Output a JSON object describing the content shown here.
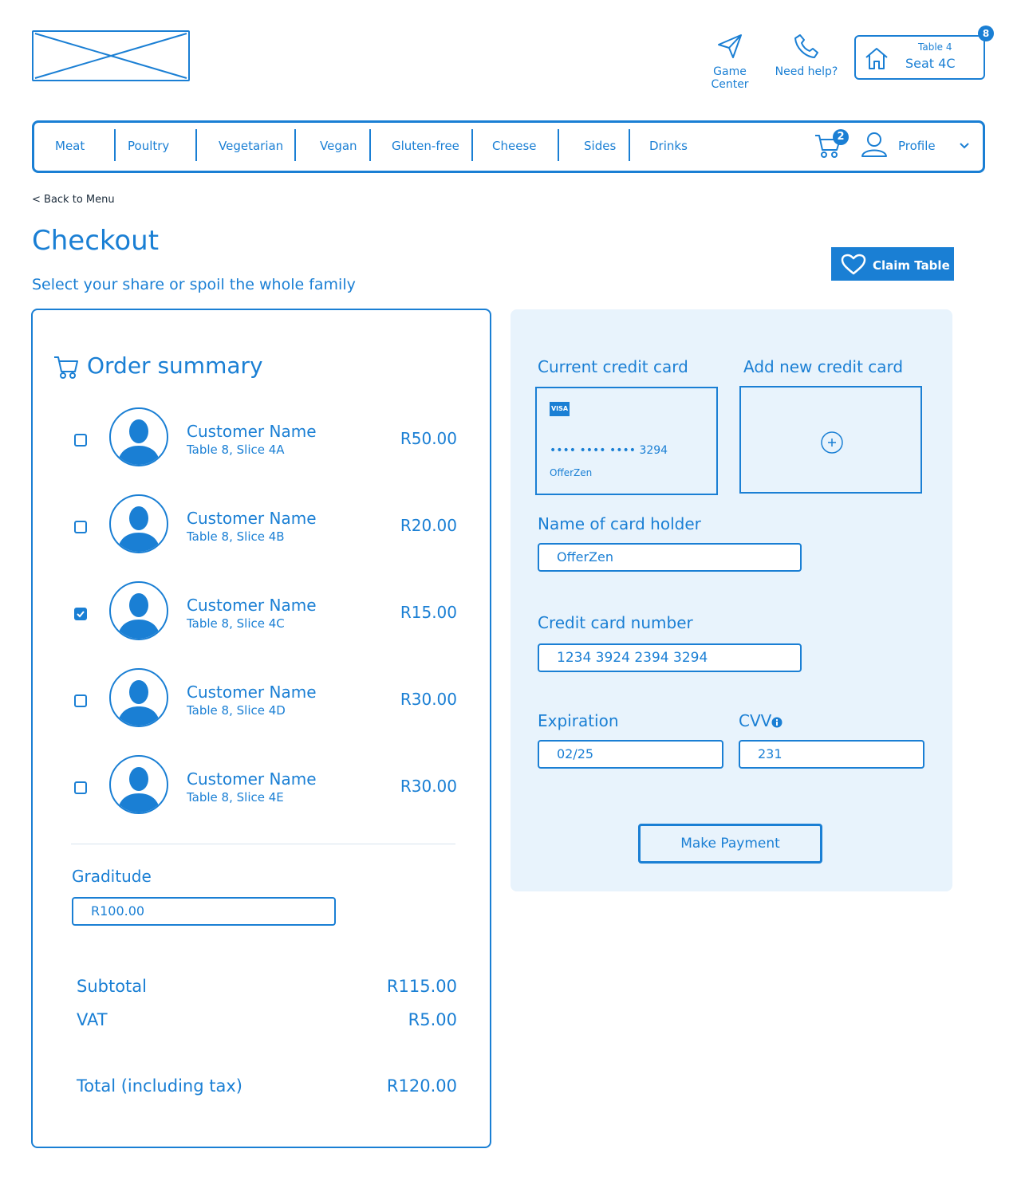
{
  "header": {
    "game_center": "Game Center",
    "need_help": "Need help?",
    "table_label": "Table 4",
    "seat_label": "Seat 4C",
    "notification_count": "8"
  },
  "nav": {
    "items": [
      "Meat",
      "Poultry",
      "Vegetarian",
      "Vegan",
      "Gluten-free",
      "Cheese",
      "Sides",
      "Drinks"
    ],
    "cart_count": "2",
    "profile": "Profile"
  },
  "page": {
    "back_link": "< Back to Menu",
    "title": "Checkout",
    "subtitle": "Select your share or spoil the whole family",
    "claim_button": "Claim Table"
  },
  "order": {
    "title": "Order summary",
    "items": [
      {
        "name": "Customer Name",
        "seat": "Table 8, Slice 4A",
        "price": "R50.00",
        "checked": false
      },
      {
        "name": "Customer Name",
        "seat": "Table 8, Slice 4B",
        "price": "R20.00",
        "checked": false
      },
      {
        "name": "Customer Name",
        "seat": "Table 8, Slice 4C",
        "price": "R15.00",
        "checked": true
      },
      {
        "name": "Customer Name",
        "seat": "Table 8, Slice 4D",
        "price": "R30.00",
        "checked": false
      },
      {
        "name": "Customer Name",
        "seat": "Table 8, Slice 4E",
        "price": "R30.00",
        "checked": false
      }
    ],
    "gratitude_label": "Graditude",
    "gratitude_value": "R100.00",
    "subtotal_label": "Subtotal",
    "subtotal_value": "R115.00",
    "vat_label": "VAT",
    "vat_value": "R5.00",
    "total_label": "Total (including tax)",
    "total_value": "R120.00"
  },
  "payment": {
    "current_card_label": "Current credit card",
    "add_card_label": "Add new credit card",
    "card_brand": "VISA",
    "card_masked": "•••• •••• •••• 3294",
    "card_holder_on_card": "OfferZen",
    "holder_label": "Name of card holder",
    "holder_value": "OfferZen",
    "number_label": "Credit card number",
    "number_value": "1234  3924  2394  3294",
    "expiration_label": "Expiration",
    "expiration_value": "02/25",
    "cvv_label": "CVV",
    "cvv_value": "231",
    "pay_button": "Make Payment"
  },
  "colors": {
    "accent": "#1a7fd4",
    "panel_bg": "#e8f3fc"
  }
}
